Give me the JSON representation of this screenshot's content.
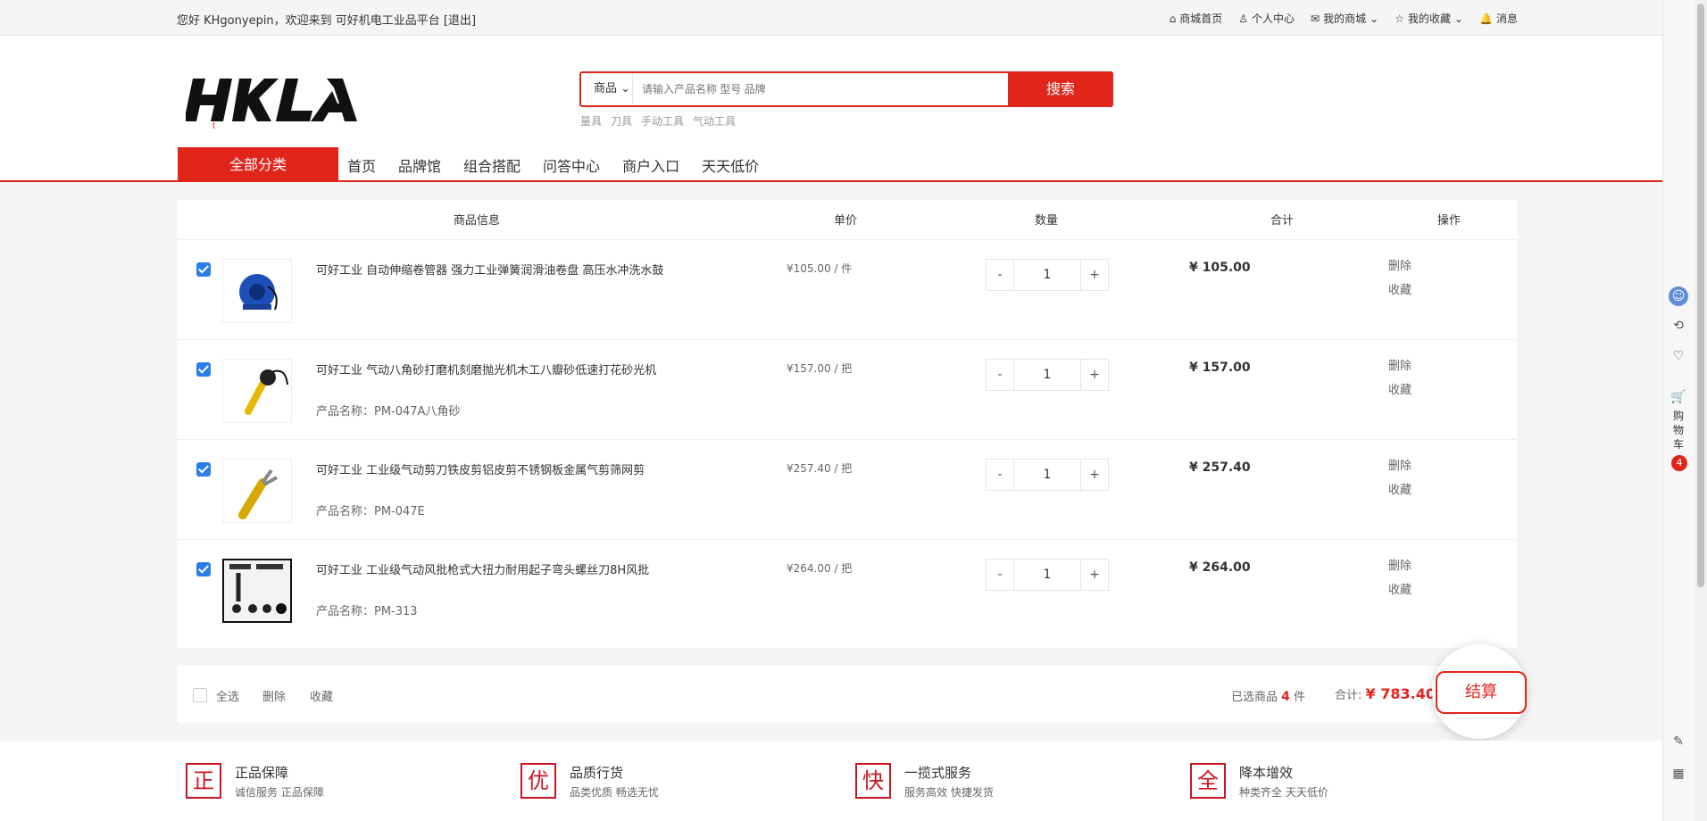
{
  "topbar": {
    "greeting": "您好 KHgonyepin，欢迎来到 可好机电工业品平台 [退出]",
    "links": {
      "home": "商城首页",
      "profile": "个人中心",
      "my_shop": "我的商城",
      "favorites": "我的收藏",
      "messages": "消息"
    }
  },
  "header": {
    "logo_text": "HKLA",
    "search": {
      "type": "商品",
      "placeholder": "请输入产品名称 型号 品牌",
      "button": "搜索",
      "hotwords": [
        "量具",
        "刀具",
        "手动工具",
        "气动工具"
      ]
    },
    "nav": {
      "all_categories": "全部分类",
      "items": [
        "首页",
        "品牌馆",
        "组合搭配",
        "问答中心",
        "商户入口",
        "天天低价"
      ]
    }
  },
  "cart": {
    "columns": {
      "info": "商品信息",
      "price": "单价",
      "qty": "数量",
      "total": "合计",
      "ops": "操作"
    },
    "items": [
      {
        "title": "可好工业 自动伸缩卷管器 强力工业弹簧润滑油卷盘 高压水冲洗水鼓",
        "subtitle": "",
        "price": "¥105.00 / 件",
        "qty": "1",
        "total": "¥ 105.00",
        "delete": "删除",
        "favorite": "收藏"
      },
      {
        "title": "可好工业 气动八角砂打磨机刻磨抛光机木工八瓣砂低速打花砂光机",
        "subtitle": "产品名称：PM-047A八角砂",
        "price": "¥157.00 / 把",
        "qty": "1",
        "total": "¥ 157.00",
        "delete": "删除",
        "favorite": "收藏"
      },
      {
        "title": "可好工业 工业级气动剪刀铁皮剪铝皮剪不锈钢板金属气剪筛网剪",
        "subtitle": "产品名称：PM-047E",
        "price": "¥257.40 / 把",
        "qty": "1",
        "total": "¥ 257.40",
        "delete": "删除",
        "favorite": "收藏"
      },
      {
        "title": "可好工业 工业级气动风批枪式大扭力耐用起子弯头螺丝刀8H风批",
        "subtitle": "产品名称：PM-313",
        "price": "¥264.00 / 把",
        "qty": "1",
        "total": "¥ 264.00",
        "delete": "删除",
        "favorite": "收藏"
      }
    ],
    "footer": {
      "select_all": "全选",
      "delete": "删除",
      "favorite": "收藏",
      "selected_prefix": "已选商品",
      "selected_count": "4",
      "selected_unit": "件",
      "sum_label": "合计:",
      "sum_value": "¥ 783.40",
      "checkout": "结算"
    }
  },
  "service": [
    {
      "badge": "正",
      "name": "正品保障",
      "desc": "诚信服务 正品保障"
    },
    {
      "badge": "优",
      "name": "品质行货",
      "desc": "品类优质 畅选无忧"
    },
    {
      "badge": "快",
      "name": "一揽式服务",
      "desc": "服务高效 快捷发货"
    },
    {
      "badge": "全",
      "name": "降本增效",
      "desc": "种类齐全 天天低价"
    }
  ],
  "sidebar": {
    "cart_label": "购物车",
    "cart_count": "4"
  },
  "colors": {
    "brand": "#e1251b",
    "checkbox": "#2b7de9"
  }
}
